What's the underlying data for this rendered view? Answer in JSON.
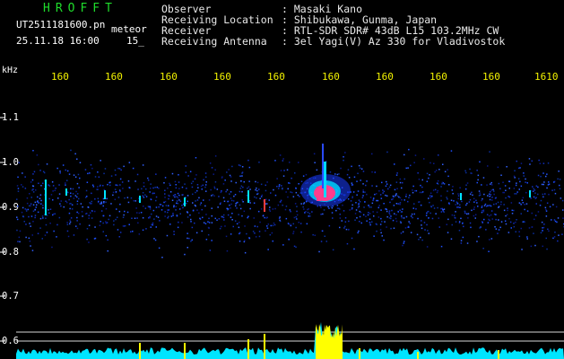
{
  "header": {
    "title": "HROFFT",
    "filename": "UT2511181600.pn",
    "meteor_label": "meteor",
    "datetime": "25.11.18 16:00",
    "count": "15_",
    "info": [
      {
        "label": "Observer",
        "value": ": Masaki Kano"
      },
      {
        "label": "Receiving Location",
        "value": ": Shibukawa, Gunma, Japan"
      },
      {
        "label": "Receiver",
        "value": ": RTL-SDR SDR# 43dB L15 103.2MHz CW"
      },
      {
        "label": "Receiving Antenna",
        "value": ": 3el Yagi(V) Az 330 for Vladivostok"
      }
    ]
  },
  "axes": {
    "unit": "kHz",
    "time_ticks": [
      "160",
      "160",
      "160",
      "160",
      "160",
      "160",
      "160",
      "160",
      "160",
      "1610"
    ],
    "freq_ticks": [
      "1.1",
      "1.0",
      "0.9",
      "0.8",
      "0.7",
      "0.6"
    ]
  },
  "colors": {
    "background": "#000000",
    "title": "#1fdc2c",
    "time_axis": "#f2f200",
    "noise_floor": "#00e5ff",
    "echo_strong": "#ff3c8c",
    "echo_medium": "#ffff00"
  }
}
